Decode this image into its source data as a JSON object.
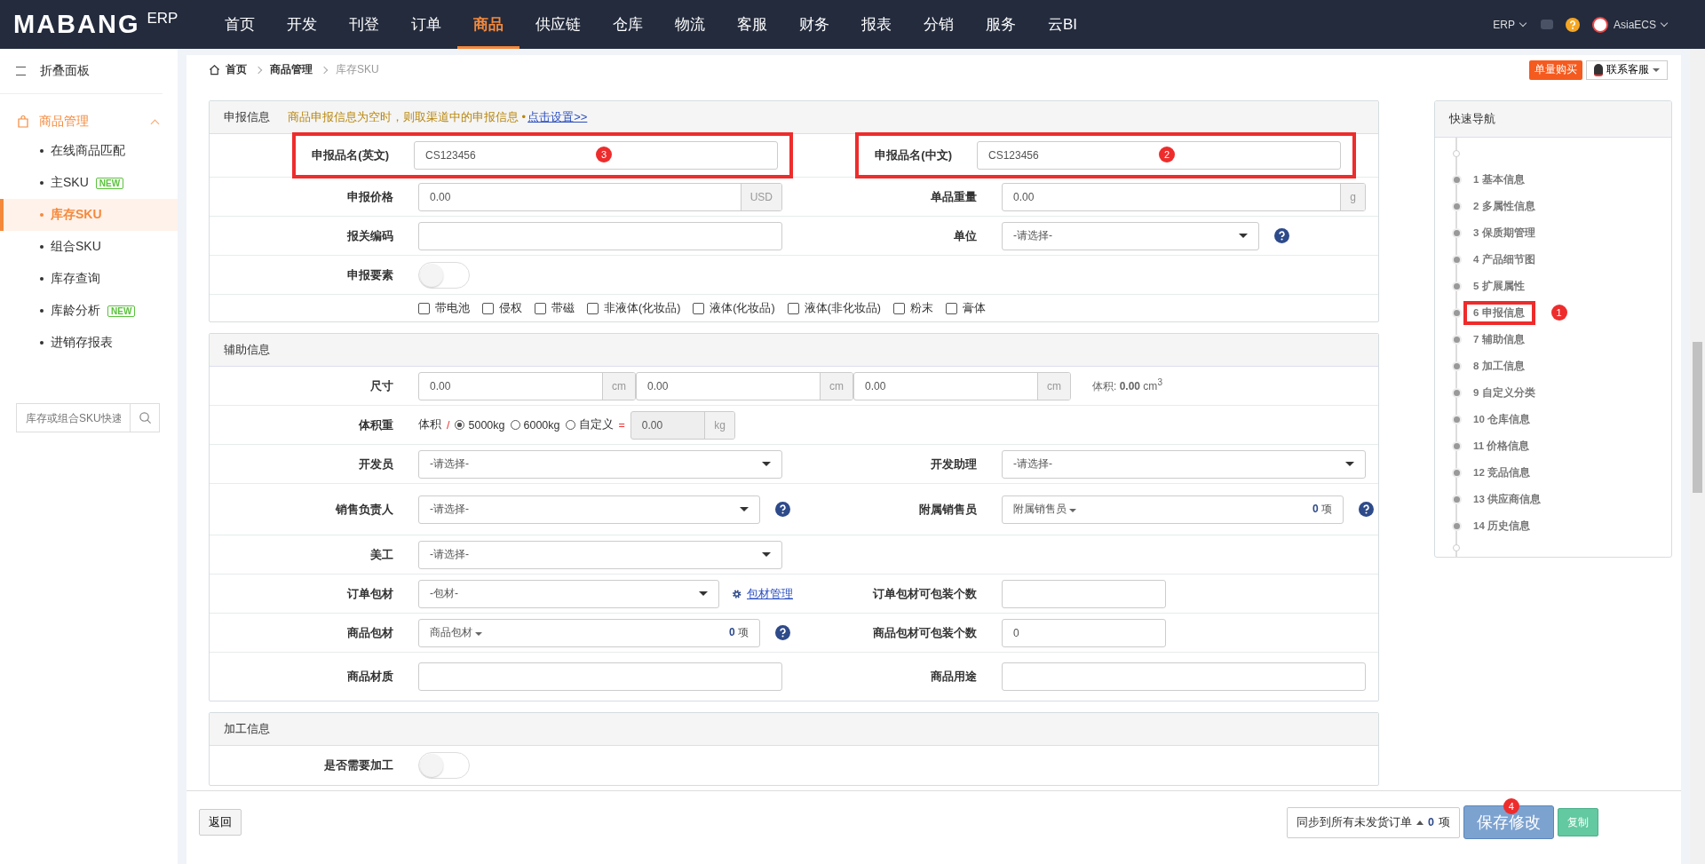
{
  "topbar": {
    "logo": "MABANG",
    "logo_suffix": "ERP",
    "menu": [
      {
        "label": "首页",
        "selected": false
      },
      {
        "label": "开发",
        "selected": false
      },
      {
        "label": "刊登",
        "selected": false
      },
      {
        "label": "订单",
        "selected": false
      },
      {
        "label": "商品",
        "selected": true
      },
      {
        "label": "供应链",
        "selected": false
      },
      {
        "label": "仓库",
        "selected": false
      },
      {
        "label": "物流",
        "selected": false
      },
      {
        "label": "客服",
        "selected": false
      },
      {
        "label": "财务",
        "selected": false
      },
      {
        "label": "报表",
        "selected": false
      },
      {
        "label": "分销",
        "selected": false
      },
      {
        "label": "服务",
        "selected": false
      },
      {
        "label": "云BI",
        "selected": false
      }
    ],
    "erp": "ERP",
    "user": "AsiaECS"
  },
  "sidebar": {
    "collapse": "折叠面板",
    "group": {
      "label": "商品管理",
      "expanded": true
    },
    "items": [
      {
        "label": "在线商品匹配",
        "selected": false
      },
      {
        "label": "主SKU",
        "badge": "NEW",
        "selected": false
      },
      {
        "label": "库存SKU",
        "selected": true
      },
      {
        "label": "组合SKU",
        "selected": false
      },
      {
        "label": "库存查询",
        "selected": false
      },
      {
        "label": "库龄分析",
        "badge": "NEW",
        "selected": false
      },
      {
        "label": "进销存报表",
        "selected": false
      }
    ],
    "search": {
      "placeholder": "库存或组合SKU快速"
    }
  },
  "breadcrumb": [
    "首页",
    "商品管理",
    "库存SKU"
  ],
  "header_buttons": {
    "buy": "单量购买",
    "support": "联系客服"
  },
  "declare": {
    "title": "申报信息",
    "note": "商品申报信息为空时，则取渠道中的申报信息 •",
    "link": "点击设置>>",
    "name_en": {
      "label": "申报品名(英文)",
      "value": "CS123456",
      "highlighted": true,
      "badge": "3"
    },
    "name_cn": {
      "label": "申报品名(中文)",
      "value": "CS123456",
      "highlighted": true,
      "badge": "2"
    },
    "price": {
      "label": "申报价格",
      "value": "0.00",
      "unit": "USD"
    },
    "weight": {
      "label": "单品重量",
      "value": "0.00",
      "unit": "g"
    },
    "hs_code": {
      "label": "报关编码"
    },
    "unit": {
      "label": "单位",
      "placeholder": "-请选择-"
    },
    "elements": {
      "label": "申报要素",
      "on": false
    },
    "attributes": [
      {
        "label": "带电池",
        "checked": false
      },
      {
        "label": "侵权",
        "checked": false
      },
      {
        "label": "带磁",
        "checked": false
      },
      {
        "label": "非液体(化妆品)",
        "checked": false
      },
      {
        "label": "液体(化妆品)",
        "checked": false
      },
      {
        "label": "液体(非化妆品)",
        "checked": false
      },
      {
        "label": "粉末",
        "checked": false
      },
      {
        "label": "膏体",
        "checked": false
      }
    ]
  },
  "aux": {
    "title": "辅助信息",
    "size": {
      "label": "尺寸",
      "dims": [
        {
          "value": "0.00",
          "unit": "cm"
        },
        {
          "value": "0.00",
          "unit": "cm"
        },
        {
          "value": "0.00",
          "unit": "cm"
        }
      ],
      "volume": "体积: **0.00** cm$^{3}$"
    },
    "vol_weight": {
      "label": "体积重",
      "prefix": "体积",
      "slash": "/",
      "options": [
        {
          "label": "5000kg",
          "selected": true
        },
        {
          "label": "6000kg",
          "selected": false
        },
        {
          "label": "自定义",
          "selected": false
        }
      ],
      "equals": "=",
      "value": "0.00",
      "unit": "kg"
    },
    "developer": {
      "label": "开发员",
      "placeholder": "-请选择-"
    },
    "dev_assistant": {
      "label": "开发助理",
      "placeholder": "-请选择-"
    },
    "sales_owner": {
      "label": "销售负责人",
      "placeholder": "-请选择-"
    },
    "sub_sales": {
      "label": "附属销售员",
      "dropdown": "附属销售员",
      "count": "0",
      "count_unit": "项"
    },
    "artist": {
      "label": "美工",
      "placeholder": "-请选择-"
    },
    "order_pack": {
      "label": "订单包材",
      "placeholder": "-包材-",
      "link": "包材管理"
    },
    "order_pack_qty": {
      "label": "订单包材可包装个数"
    },
    "goods_pack": {
      "label": "商品包材",
      "dropdown": "商品包材",
      "count": "0",
      "count_unit": "项"
    },
    "goods_pack_qty": {
      "label": "商品包材可包装个数",
      "value": "0"
    },
    "material": {
      "label": "商品材质"
    },
    "usage": {
      "label": "商品用途"
    }
  },
  "processing": {
    "title": "加工信息",
    "need_label": "是否需要加工",
    "need_on": false
  },
  "quick_nav": {
    "title": "快速导航",
    "items": [
      {
        "label": "1 基本信息",
        "highlighted": false
      },
      {
        "label": "2 多属性信息",
        "highlighted": false
      },
      {
        "label": "3 保质期管理",
        "highlighted": false
      },
      {
        "label": "4 产品细节图",
        "highlighted": false
      },
      {
        "label": "5 扩展属性",
        "highlighted": false
      },
      {
        "label": "6 申报信息",
        "highlighted": true,
        "badge": "1"
      },
      {
        "label": "7 辅助信息",
        "highlighted": false
      },
      {
        "label": "8 加工信息",
        "highlighted": false
      },
      {
        "label": "9 自定义分类",
        "highlighted": false
      },
      {
        "label": "10 仓库信息",
        "highlighted": false
      },
      {
        "label": "11 价格信息",
        "highlighted": false
      },
      {
        "label": "12 竞品信息",
        "highlighted": false
      },
      {
        "label": "13 供应商信息",
        "highlighted": false
      },
      {
        "label": "14 历史信息",
        "highlighted": false
      }
    ]
  },
  "footer": {
    "back": "返回",
    "sync_label": "同步到所有未发货订单",
    "sync_count": "0",
    "sync_unit": "项",
    "save": "保存修改",
    "save_badge": "4",
    "copy": "复制"
  }
}
